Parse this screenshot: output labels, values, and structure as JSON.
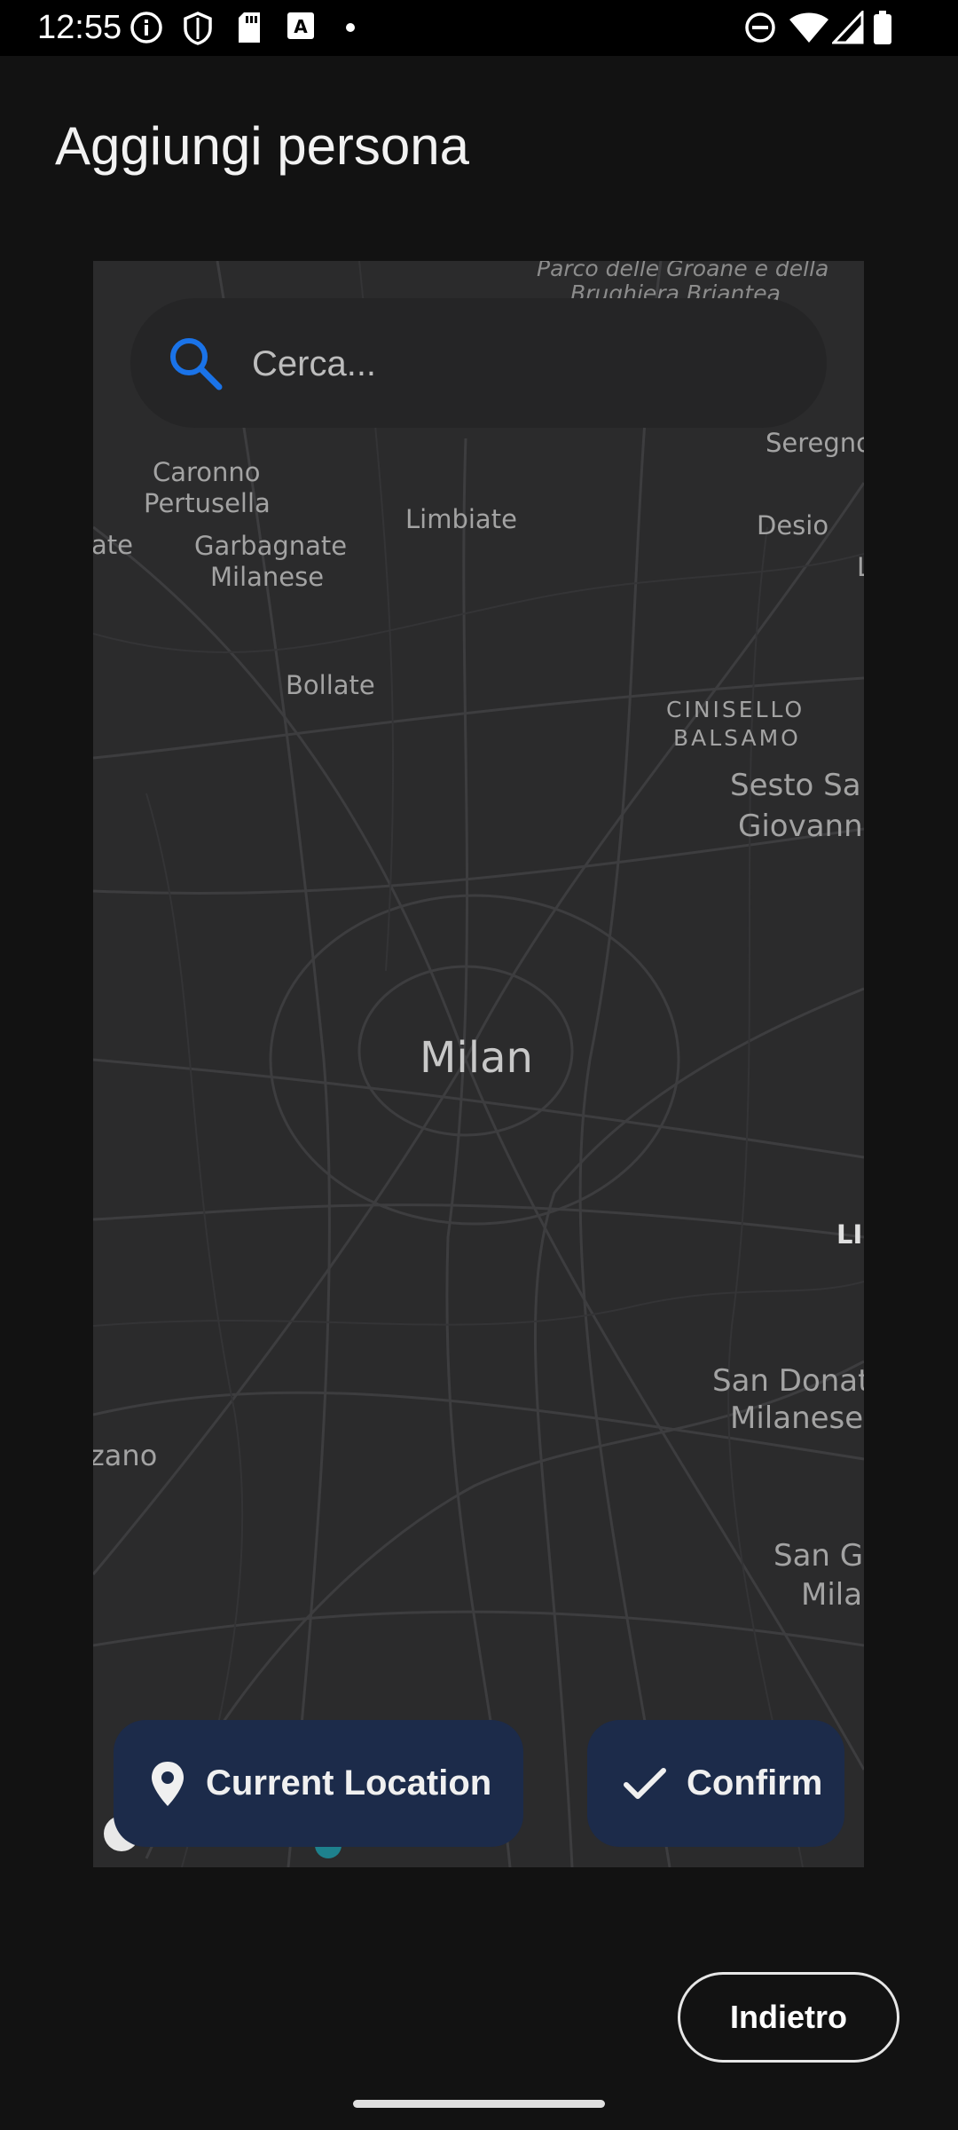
{
  "status_bar": {
    "time": "12:55",
    "icons": [
      "info-icon",
      "shield-icon",
      "sd-card-icon",
      "font-a-icon",
      "dot-icon",
      "do-not-disturb-icon",
      "wifi-icon",
      "signal-icon",
      "battery-icon"
    ]
  },
  "header": {
    "title": "Aggiungi persona"
  },
  "map": {
    "search": {
      "placeholder": "Cerca..."
    },
    "labels": {
      "parco": "Parco delle Groane e della",
      "brughiera": "Brughiera Briantea",
      "seregno": "Seregno",
      "caronno": "Caronno",
      "pertusella": "Pertusella",
      "limbiate": "Limbiate",
      "desio": "Desio",
      "ate": "ate",
      "garbagnate": "Garbagnate",
      "milanese1": "Milanese",
      "l_edge": "L",
      "bollate": "Bollate",
      "cinisello": "CINISELLO",
      "balsamo": "BALSAMO",
      "sesto1": "Sesto Sa",
      "sesto2": "Giovann",
      "milan": "Milan",
      "li_edge": "LI",
      "sandonato1": "San Donat",
      "sandonato2": "Milanese",
      "zano": "zano",
      "sang1": "San G",
      "sang2": "Mila"
    },
    "current_location_label": "Current Location",
    "confirm_label": "Confirm"
  },
  "footer": {
    "back_label": "Indietro"
  },
  "colors": {
    "background": "#121212",
    "map_background": "#2b2b2c",
    "button_background": "#1c2b4a",
    "accent": "#1a73e8"
  }
}
